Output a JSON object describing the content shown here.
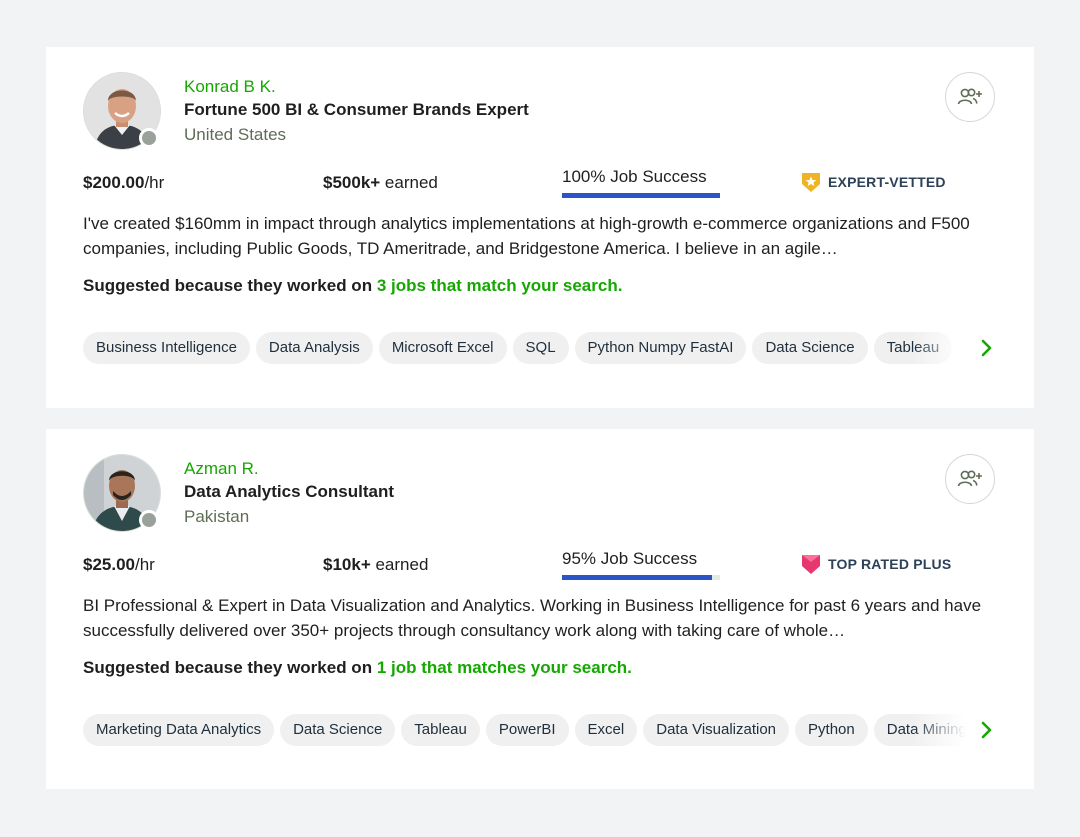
{
  "freelancers": [
    {
      "name": "Konrad B K.",
      "headline": "Fortune 500 BI & Consumer Brands Expert",
      "location": "United States",
      "rate_amount": "$200.00",
      "rate_unit": "/hr",
      "earned_amount": "$500k+",
      "earned_label": " earned",
      "job_success": "100% Job Success",
      "job_success_value": 100,
      "badge": "EXPERT-VETTED",
      "badge_icon": "expert-vetted-icon",
      "description": "I've created $160mm in impact through analytics implementations at high-growth e-commerce organizations and F500 companies, including Public Goods, TD Ameritrade, and Bridgestone America. I believe in an agile…",
      "suggest_prefix": "Suggested because they worked on ",
      "suggest_link": "3 jobs that match your search.",
      "skills": [
        "Business Intelligence",
        "Data Analysis",
        "Microsoft Excel",
        "SQL",
        "Python Numpy FastAI",
        "Data Science",
        "Tableau"
      ]
    },
    {
      "name": "Azman R.",
      "headline": "Data Analytics Consultant",
      "location": "Pakistan",
      "rate_amount": "$25.00",
      "rate_unit": "/hr",
      "earned_amount": "$10k+",
      "earned_label": " earned",
      "job_success": "95% Job Success",
      "job_success_value": 95,
      "badge": "TOP RATED PLUS",
      "badge_icon": "top-rated-plus-icon",
      "description": "BI Professional & Expert in Data Visualization and Analytics. Working in Business Intelligence for past 6 years and have successfully delivered over 350+ projects through consultancy work along with taking care of whole…",
      "suggest_prefix": "Suggested because they worked on ",
      "suggest_link": "1 job that matches your search.",
      "skills": [
        "Marketing Data Analytics",
        "Data Science",
        "Tableau",
        "PowerBI",
        "Excel",
        "Data Visualization",
        "Python",
        "Data Mining"
      ]
    }
  ],
  "colors": {
    "accent_green": "#14a800",
    "progress_blue": "#2b55c6",
    "badge_gold": "#f0b323",
    "badge_pink": "#e6376e"
  },
  "icons": {
    "invite": "add-user-icon",
    "scroll_next": "chevron-right-icon",
    "online_status": "status-dot"
  }
}
